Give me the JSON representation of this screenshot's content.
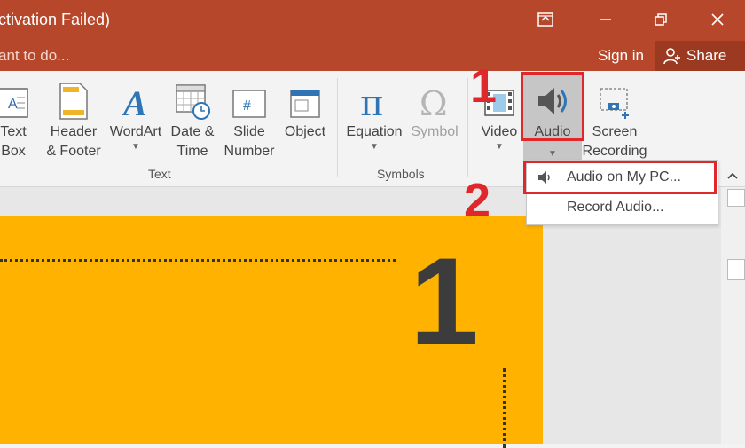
{
  "titlebar": {
    "title": "ctivation Failed)",
    "icons": [
      "restore-ribbon-icon",
      "minimize-icon",
      "restore-window-icon",
      "close-icon"
    ]
  },
  "tellbar": {
    "tell_me": "ant to do...",
    "sign_in": "Sign in",
    "share": "Share"
  },
  "ribbon": {
    "text_group": {
      "label": "Text",
      "buttons": [
        {
          "line1": "Text",
          "line2": "Box"
        },
        {
          "line1": "Header",
          "line2": "& Footer"
        },
        {
          "line1": "WordArt",
          "line2": ""
        },
        {
          "line1": "Date &",
          "line2": "Time"
        },
        {
          "line1": "Slide",
          "line2": "Number"
        },
        {
          "line1": "Object",
          "line2": ""
        }
      ]
    },
    "symbols_group": {
      "label": "Symbols",
      "buttons": [
        {
          "line1": "Equation",
          "line2": ""
        },
        {
          "line1": "Symbol",
          "line2": ""
        }
      ]
    },
    "media_group": {
      "buttons": [
        {
          "line1": "Video",
          "line2": ""
        },
        {
          "line1": "Audio",
          "line2": ""
        },
        {
          "line1": "Screen",
          "line2": "Recording"
        }
      ]
    }
  },
  "audio_menu": {
    "items": [
      {
        "label": "Audio on My PC..."
      },
      {
        "label": "Record Audio..."
      }
    ]
  },
  "annotations": {
    "step1": "1",
    "step2": "2",
    "highlight_color": "#e0282c"
  },
  "slide": {
    "number": "1",
    "background": "#ffb300"
  },
  "colors": {
    "titlebar": "#b7472a",
    "ribbon_bg": "#f3f3f3"
  }
}
